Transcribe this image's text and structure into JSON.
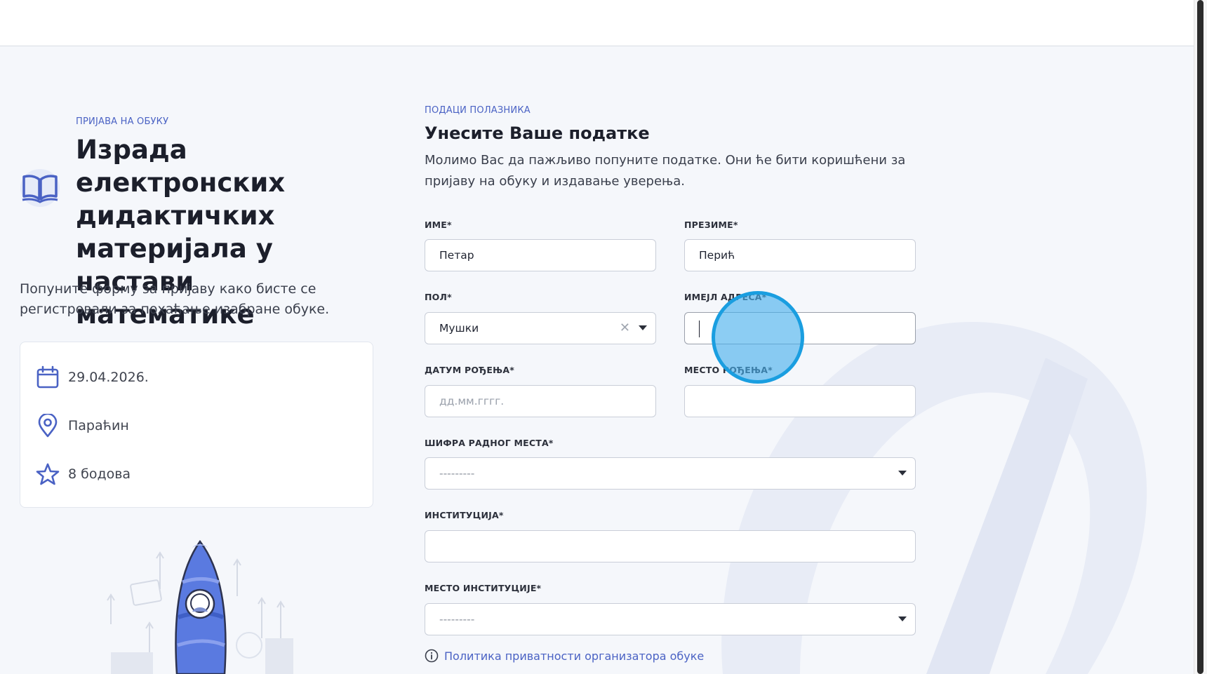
{
  "sidebar": {
    "eyebrow": "ПРИЈАВА НА ОБУКУ",
    "course_title": "Израда електронских дидактичких материјала у настави математике",
    "intro": "Попуните форму за пријаву како бисте се регистровали за похађање изабране обуке.",
    "info": {
      "date": "29.04.2026.",
      "location": "Параћин",
      "points": "8 бодова"
    }
  },
  "form": {
    "eyebrow": "ПОДАЦИ ПОЛАЗНИКА",
    "title": "Унесите Ваше податке",
    "description": "Молимо Вас да пажљиво попуните податке. Они ће бити коришћени за пријаву на обуку и издавање уверења.",
    "fields": {
      "first_name": {
        "label": "ИМЕ*",
        "value": "Петар"
      },
      "last_name": {
        "label": "ПРЕЗИМЕ*",
        "value": "Перић"
      },
      "gender": {
        "label": "ПОЛ*",
        "value": "Мушки"
      },
      "email": {
        "label": "ИМЕЈЛ АДРЕСА*",
        "value": ""
      },
      "birth_date": {
        "label": "ДАТУМ РОЂЕЊА*",
        "placeholder": "дд.мм.гггг."
      },
      "birth_place": {
        "label": "МЕСТО РОЂЕЊА*",
        "value": ""
      },
      "job_code": {
        "label": "ШИФРА РАДНОГ МЕСТА*",
        "value": "---------"
      },
      "institution": {
        "label": "ИНСТИТУЦИЈА*",
        "value": ""
      },
      "institution_place": {
        "label": "МЕСТО ИНСТИТУЦИЈЕ*",
        "value": "---------"
      }
    },
    "privacy_link": "Политика приватности организатора обуке"
  },
  "colors": {
    "accent": "#4a62c4",
    "background": "#f5f7fb",
    "click_indicator": "#1a9ee0"
  }
}
